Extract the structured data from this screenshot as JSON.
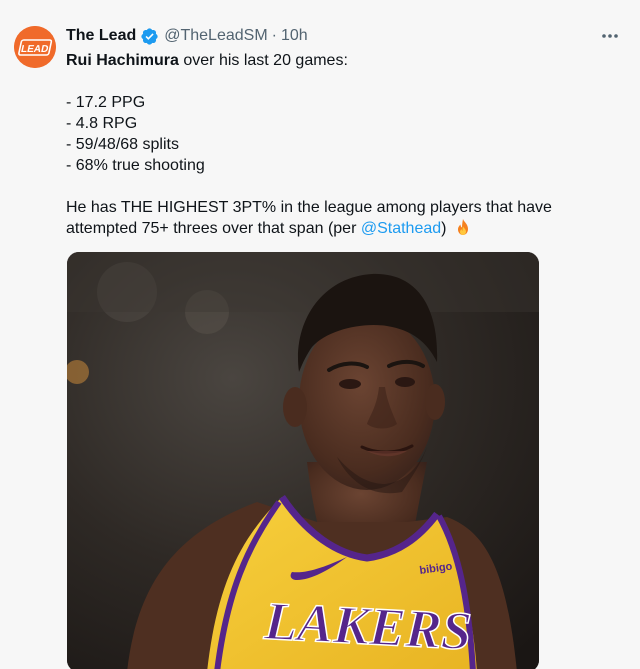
{
  "tweet": {
    "display_name": "The Lead",
    "handle": "@TheLeadSM",
    "separator": "·",
    "time": "10h",
    "verified": true,
    "avatar_text": "LEAD",
    "lead_bold": "Rui Hachimura",
    "lead_rest": " over his last 20 games:",
    "stats": [
      "- 17.2 PPG",
      "- 4.8 RPG",
      "- 59/48/68 splits",
      "- 68% true shooting"
    ],
    "closing_text": "He has THE HIGHEST 3PT% in the league among players that have attempted 75+ threes over that span (per ",
    "mention": "@Stathead",
    "closing_end": ")",
    "emoji": "fire-emoji",
    "media": {
      "jersey_text": "LAKERS",
      "sponsor_text": "bibigo"
    }
  },
  "colors": {
    "accent": "#1d9bf0",
    "avatar_bg": "#f06a2a",
    "text": "#0f1419",
    "muted": "#536471",
    "jersey_gold": "#f4c42d",
    "jersey_purple": "#55258b"
  },
  "icons": {
    "verified": "verified-badge-icon",
    "more": "more-options-icon"
  }
}
